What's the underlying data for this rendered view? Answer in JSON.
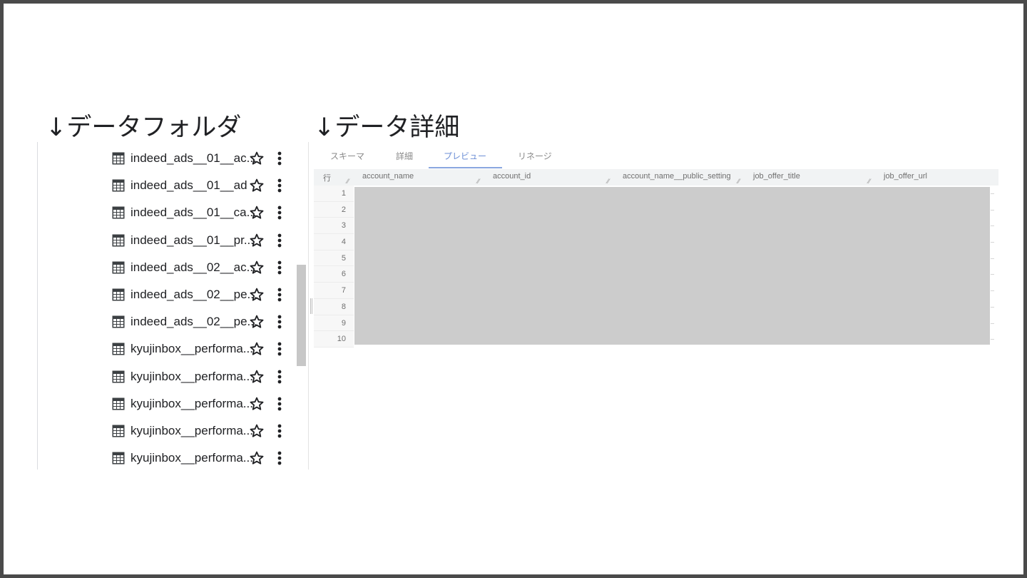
{
  "headings": {
    "left": "↓データフォルダ",
    "right": "↓データ詳細"
  },
  "folder_list": {
    "items": [
      {
        "label": "indeed_ads__01__ac..."
      },
      {
        "label": "indeed_ads__01__ad"
      },
      {
        "label": "indeed_ads__01__ca..."
      },
      {
        "label": "indeed_ads__01__pr..."
      },
      {
        "label": "indeed_ads__02__ac..."
      },
      {
        "label": "indeed_ads__02__pe..."
      },
      {
        "label": "indeed_ads__02__pe..."
      },
      {
        "label": "kyujinbox__performa..."
      },
      {
        "label": "kyujinbox__performa..."
      },
      {
        "label": "kyujinbox__performa..."
      },
      {
        "label": "kyujinbox__performa..."
      },
      {
        "label": "kyujinbox__performa..."
      }
    ],
    "item_icon": "table-icon",
    "star_icon": "star-outline-icon",
    "more_icon": "more-vert-icon"
  },
  "detail": {
    "tabs": [
      {
        "label": "スキーマ",
        "active": false
      },
      {
        "label": "詳細",
        "active": false
      },
      {
        "label": "プレビュー",
        "active": true
      },
      {
        "label": "リネージ",
        "active": false
      }
    ],
    "row_header_label": "行",
    "columns": [
      "account_name",
      "account_id",
      "account_name__public_setting",
      "job_offer_title",
      "job_offer_url"
    ],
    "row_numbers": [
      "1",
      "2",
      "3",
      "4",
      "5",
      "6",
      "7",
      "8",
      "9",
      "10"
    ]
  },
  "colors": {
    "tab_active": "#6d8fd6",
    "redacted": "#cccccc",
    "frame_border": "#4a4a4a"
  }
}
